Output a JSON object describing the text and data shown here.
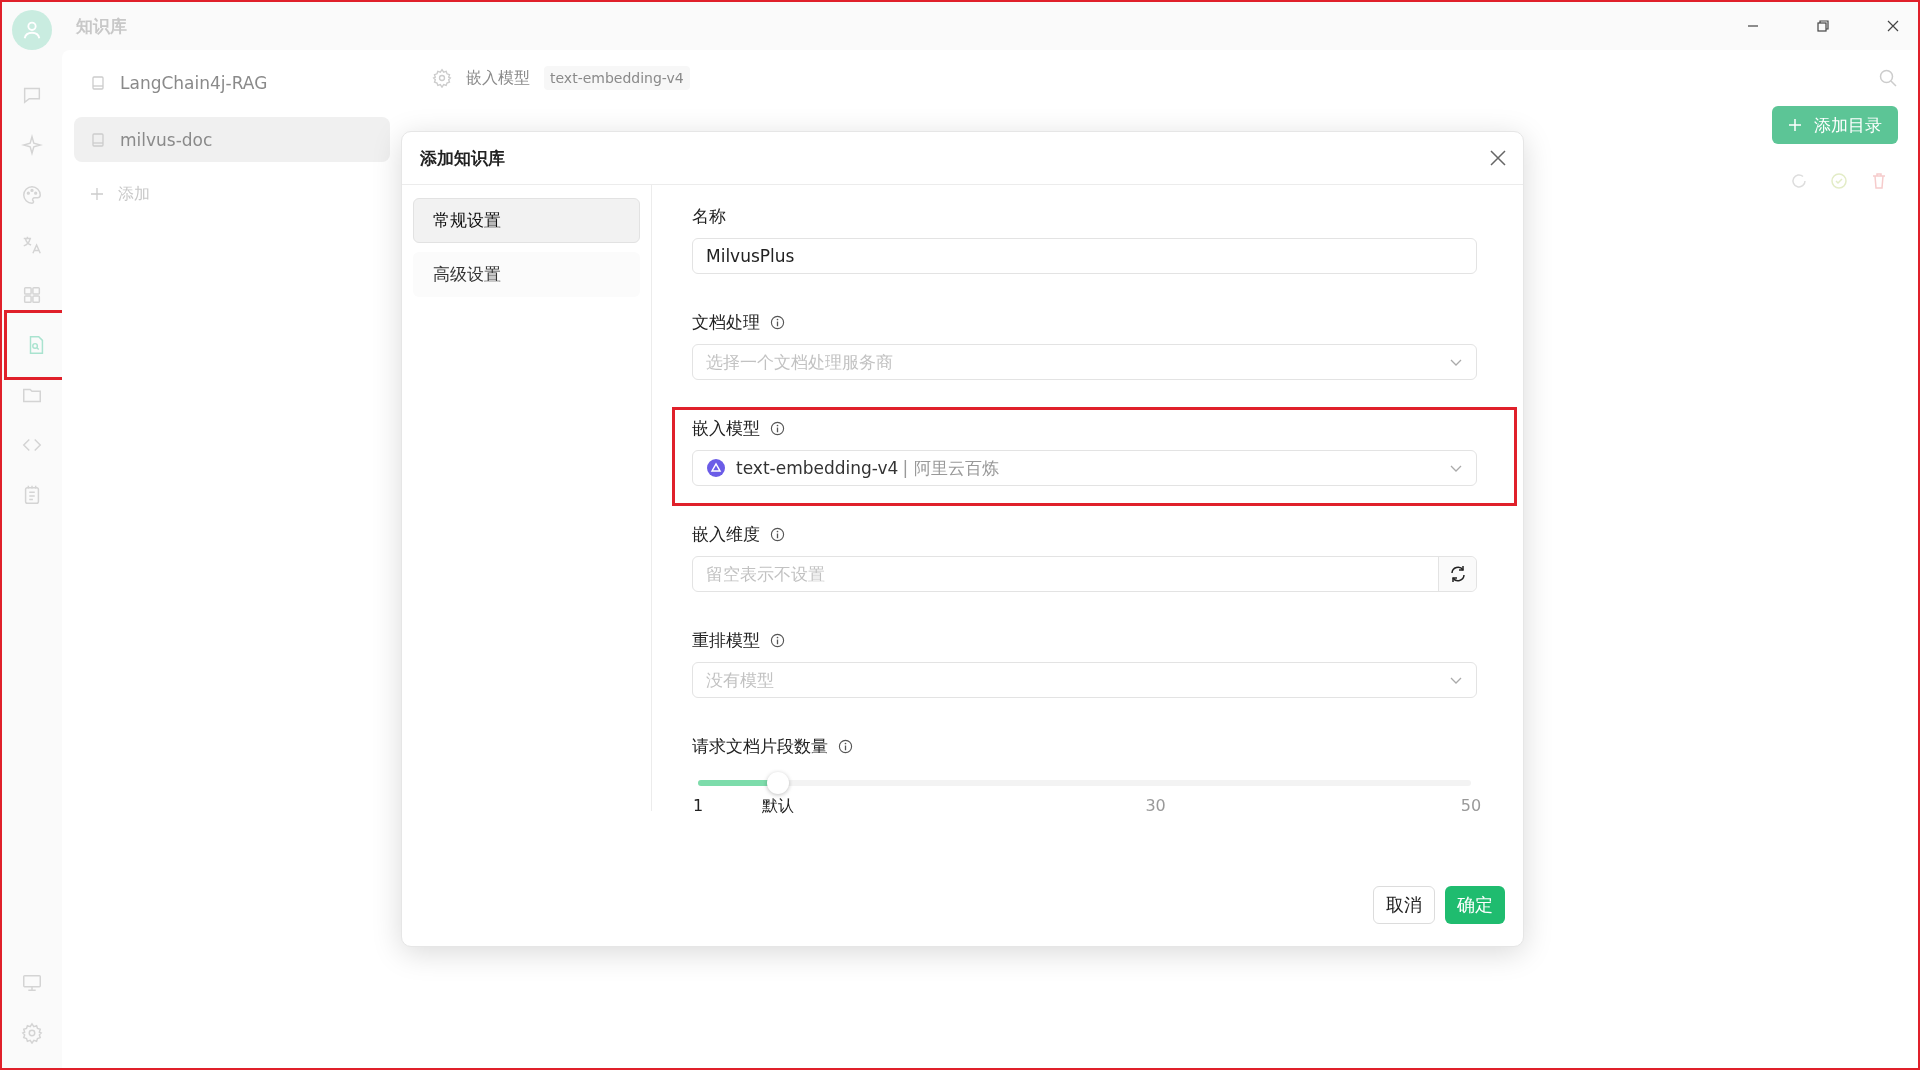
{
  "app": {
    "title": "知识库"
  },
  "nav": [
    {
      "kind": "chat",
      "selected": false,
      "highlighted": false
    },
    {
      "kind": "sparkle",
      "selected": false,
      "highlighted": false
    },
    {
      "kind": "palette",
      "selected": false,
      "highlighted": false
    },
    {
      "kind": "translate",
      "selected": false,
      "highlighted": false
    },
    {
      "kind": "grid",
      "selected": false,
      "highlighted": false
    },
    {
      "kind": "file-search",
      "selected": true,
      "highlighted": true
    },
    {
      "kind": "folder",
      "selected": false,
      "highlighted": false
    },
    {
      "kind": "code",
      "selected": false,
      "highlighted": false
    },
    {
      "kind": "notepad",
      "selected": false,
      "highlighted": false
    }
  ],
  "nav_bottom": [
    {
      "kind": "monitor"
    },
    {
      "kind": "gear"
    }
  ],
  "knowledge_bases": [
    {
      "name": "LangChain4j-RAG",
      "selected": false
    },
    {
      "name": "milvus-doc",
      "selected": true
    }
  ],
  "add_label": "添加",
  "header": {
    "label": "嵌入模型",
    "model_tag": "text-embedding-v4",
    "add_button": "添加目录"
  },
  "dialog": {
    "title": "添加知识库",
    "tabs": [
      {
        "label": "常规设置",
        "selected": true
      },
      {
        "label": "高级设置",
        "selected": false
      }
    ],
    "fields": [
      {
        "kind": "input",
        "label": "名称",
        "info": false,
        "value": "MilvusPlus",
        "highlighted": false
      },
      {
        "kind": "select",
        "label": "文档处理",
        "info": true,
        "placeholder": "选择一个文档处理服务商",
        "highlighted": false
      },
      {
        "kind": "select",
        "label": "嵌入模型",
        "info": true,
        "value": "text-embedding-v4",
        "provider": "| 阿里云百炼",
        "highlighted": true
      },
      {
        "kind": "input-refresh",
        "label": "嵌入维度",
        "info": true,
        "placeholder": "留空表示不设置",
        "highlighted": false
      },
      {
        "kind": "select",
        "label": "重排模型",
        "info": true,
        "placeholder": "没有模型",
        "highlighted": false
      },
      {
        "kind": "slider",
        "label": "请求文档片段数量",
        "info": true,
        "level": 0.103,
        "marks": [
          "1",
          "默认",
          "30",
          "50"
        ],
        "highlighted": false
      }
    ],
    "cancel": "取消",
    "ok": "确定"
  }
}
